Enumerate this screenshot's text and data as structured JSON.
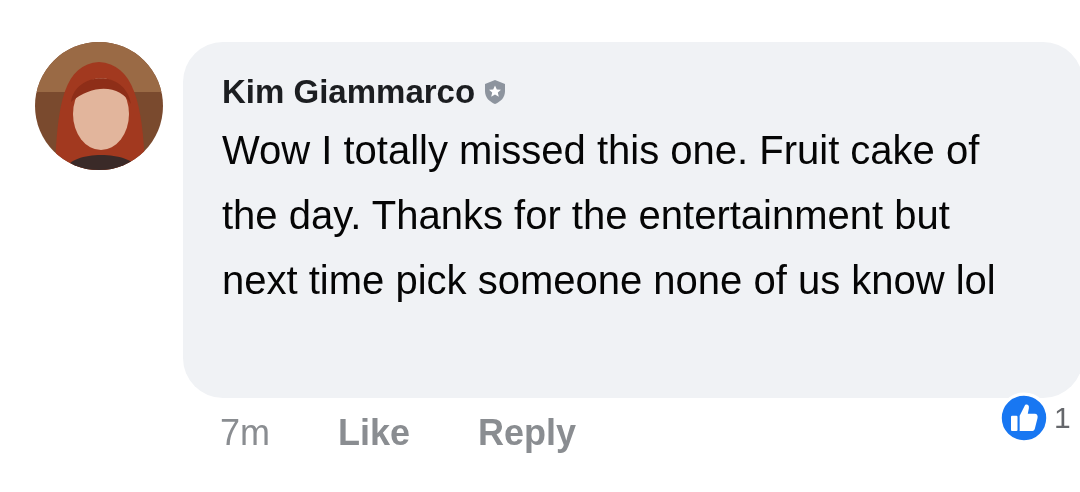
{
  "comment": {
    "author": "Kim Giammarco",
    "author_badge": true,
    "text": "Wow I totally missed this one. Fruit cake of the day. Thanks for the entertainment but next time pick someone none of us know lol",
    "time": "7m",
    "actions": [
      "Like",
      "Reply"
    ],
    "reactions": {
      "count": "1"
    }
  }
}
